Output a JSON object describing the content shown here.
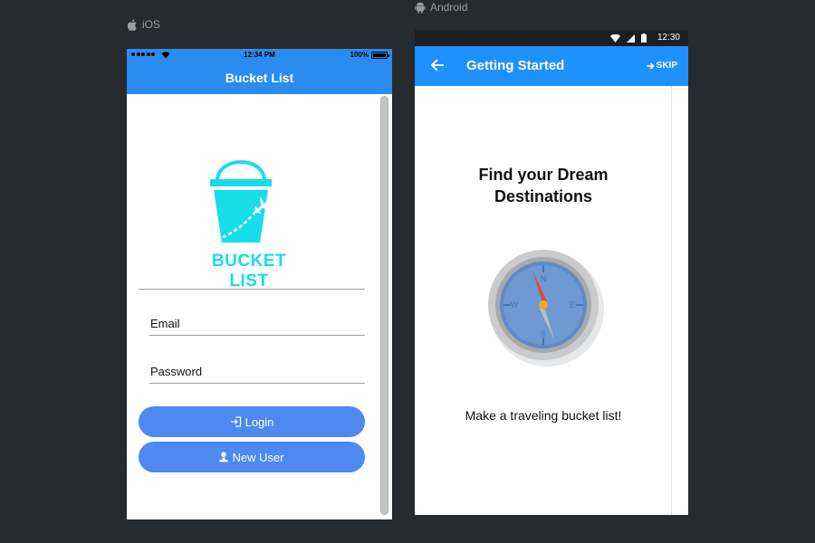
{
  "labels": {
    "ios": "iOS",
    "android": "Android"
  },
  "ios": {
    "status": {
      "time": "12:34 PM",
      "battery": "100%"
    },
    "nav_title": "Bucket List",
    "logo_text": "BUCKET LIST",
    "email_label": "Email",
    "password_label": "Password",
    "login_label": "Login",
    "new_user_label": "New User"
  },
  "android": {
    "status": {
      "time": "12:30"
    },
    "appbar_title": "Getting Started",
    "skip_label": "SKIP",
    "heading": "Find your Dream\nDestinations",
    "subtitle": "Make a traveling bucket list!"
  },
  "colors": {
    "background": "#272a2f",
    "ios_bar": "#2b8cf0",
    "ios_button": "#4d89f0",
    "android_bar": "#1f90ff",
    "logo_cyan": "#18dde8"
  },
  "icons": [
    "apple-icon",
    "android-icon",
    "signal-dots-icon",
    "wifi-icon",
    "battery-icon",
    "bucket-logo-icon",
    "airplane-icon",
    "login-icon",
    "user-icon",
    "back-arrow-icon",
    "skip-arrow-icon",
    "cell-signal-icon",
    "compass-icon"
  ]
}
